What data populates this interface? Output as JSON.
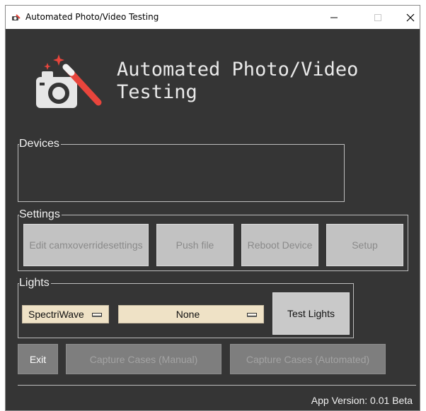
{
  "window": {
    "title": "Automated Photo/Video Testing",
    "icons": {
      "app": "camera-wand-icon",
      "minimize": "minimize-icon",
      "maximize": "maximize-icon",
      "close": "close-icon"
    }
  },
  "header": {
    "heading": "Automated Photo/Video\nTesting",
    "logo": "camera-magic-wand-icon"
  },
  "devices": {
    "label": "Devices"
  },
  "settings": {
    "label": "Settings",
    "buttons": {
      "edit": "Edit camxoverridesettings",
      "push": "Push file",
      "reboot": "Reboot Device",
      "setup": "Setup"
    }
  },
  "lights": {
    "label": "Lights",
    "light_source": "SpectriWave",
    "selection": "None",
    "test_button": "Test Lights"
  },
  "actions": {
    "exit": "Exit",
    "capture_manual": "Capture Cases (Manual)",
    "capture_automated": "Capture Cases (Automated)"
  },
  "footer": {
    "version": "App Version: 0.01 Beta"
  },
  "colors": {
    "background": "#353535",
    "accent": "#e8453c",
    "dropdown": "#efe2c6"
  }
}
